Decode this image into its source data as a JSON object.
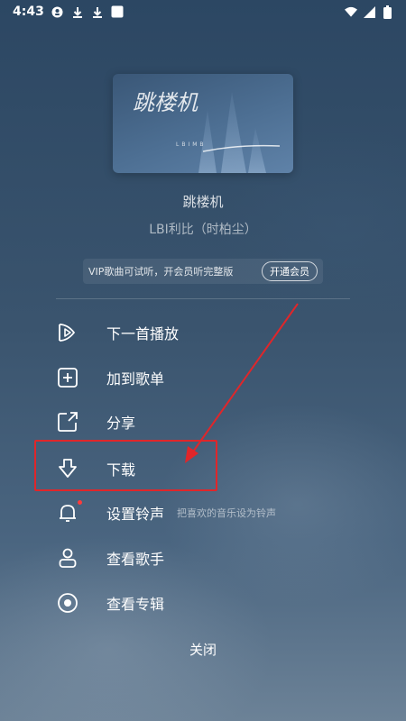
{
  "status_bar": {
    "time": "4:43",
    "left_icons": [
      "notification-icon",
      "download-icon",
      "download-icon",
      "app-icon"
    ],
    "right_icons": [
      "wifi-icon",
      "signal-icon",
      "battery-icon"
    ]
  },
  "album": {
    "cover_title_art": "跳楼机",
    "cover_subtitle": "LBIMB"
  },
  "song": {
    "title": "跳楼机",
    "artist": "LBI利比（时柏尘）"
  },
  "vip": {
    "text": "VIP歌曲可试听，开会员听完整版",
    "button_label": "开通会员"
  },
  "menu": {
    "items": [
      {
        "label": "下一首播放",
        "icon": "play-next-icon"
      },
      {
        "label": "加到歌单",
        "icon": "add-to-playlist-icon"
      },
      {
        "label": "分享",
        "icon": "share-icon"
      },
      {
        "label": "下载",
        "icon": "download-icon"
      },
      {
        "label": "设置铃声",
        "icon": "bell-icon",
        "hint": "把喜欢的音乐设为铃声"
      },
      {
        "label": "查看歌手",
        "icon": "singer-icon"
      },
      {
        "label": "查看专辑",
        "icon": "album-icon"
      }
    ]
  },
  "close_label": "关闭",
  "colors": {
    "annotation": "#e0262a",
    "background_top": "#2c4763",
    "background_bottom": "#6c8297"
  }
}
